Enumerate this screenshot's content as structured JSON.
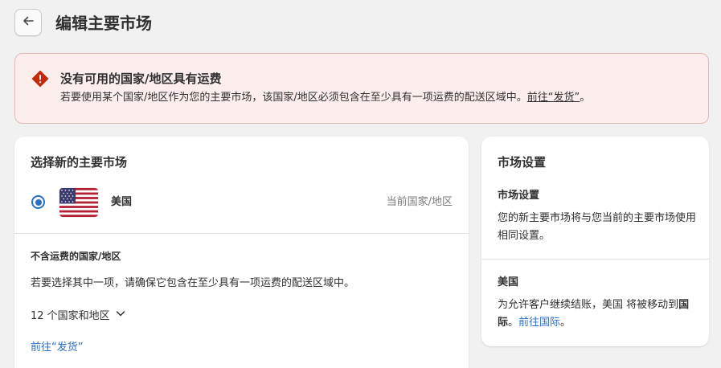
{
  "header": {
    "title": "编辑主要市场",
    "back_icon": "arrow-left-icon"
  },
  "banner": {
    "icon": "alert-diamond-icon",
    "title": "没有可用的国家/地区具有运费",
    "text": "若要使用某个国家/地区作为您的主要市场，该国家/地区必须包含在至少具有一项运费的配送区域中。",
    "link": "前往“发货”",
    "text_end": "。",
    "colors": {
      "background": "#fdeeee",
      "border": "#e3b7b3",
      "icon": "#c5280c"
    }
  },
  "select_card": {
    "title": "选择新的主要市场",
    "market": {
      "name": "美国",
      "flag_icon": "us-flag-icon",
      "current_label": "当前国家/地区",
      "selected": true
    },
    "unavailable": {
      "heading": "不含运费的国家/地区",
      "text": "若要选择其中一项，请确保它包含在至少具有一项运费的配送区域中。",
      "count_label": "12 个国家和地区",
      "link": "前往“发货”"
    }
  },
  "settings_card": {
    "title": "市场设置",
    "section1": {
      "title": "市场设置",
      "text": "您的新主要市场将与您当前的主要市场使用相同设置。"
    },
    "section2": {
      "title": "美国",
      "text_prefix": "为允许客户继续结账，美国 将被移动到",
      "text_bold": "国际",
      "text_mid": "。",
      "link": "前往国际",
      "text_end": "。"
    }
  },
  "colors": {
    "accent": "#2c6ecb",
    "background": "#f1f1f1",
    "card": "#ffffff"
  }
}
